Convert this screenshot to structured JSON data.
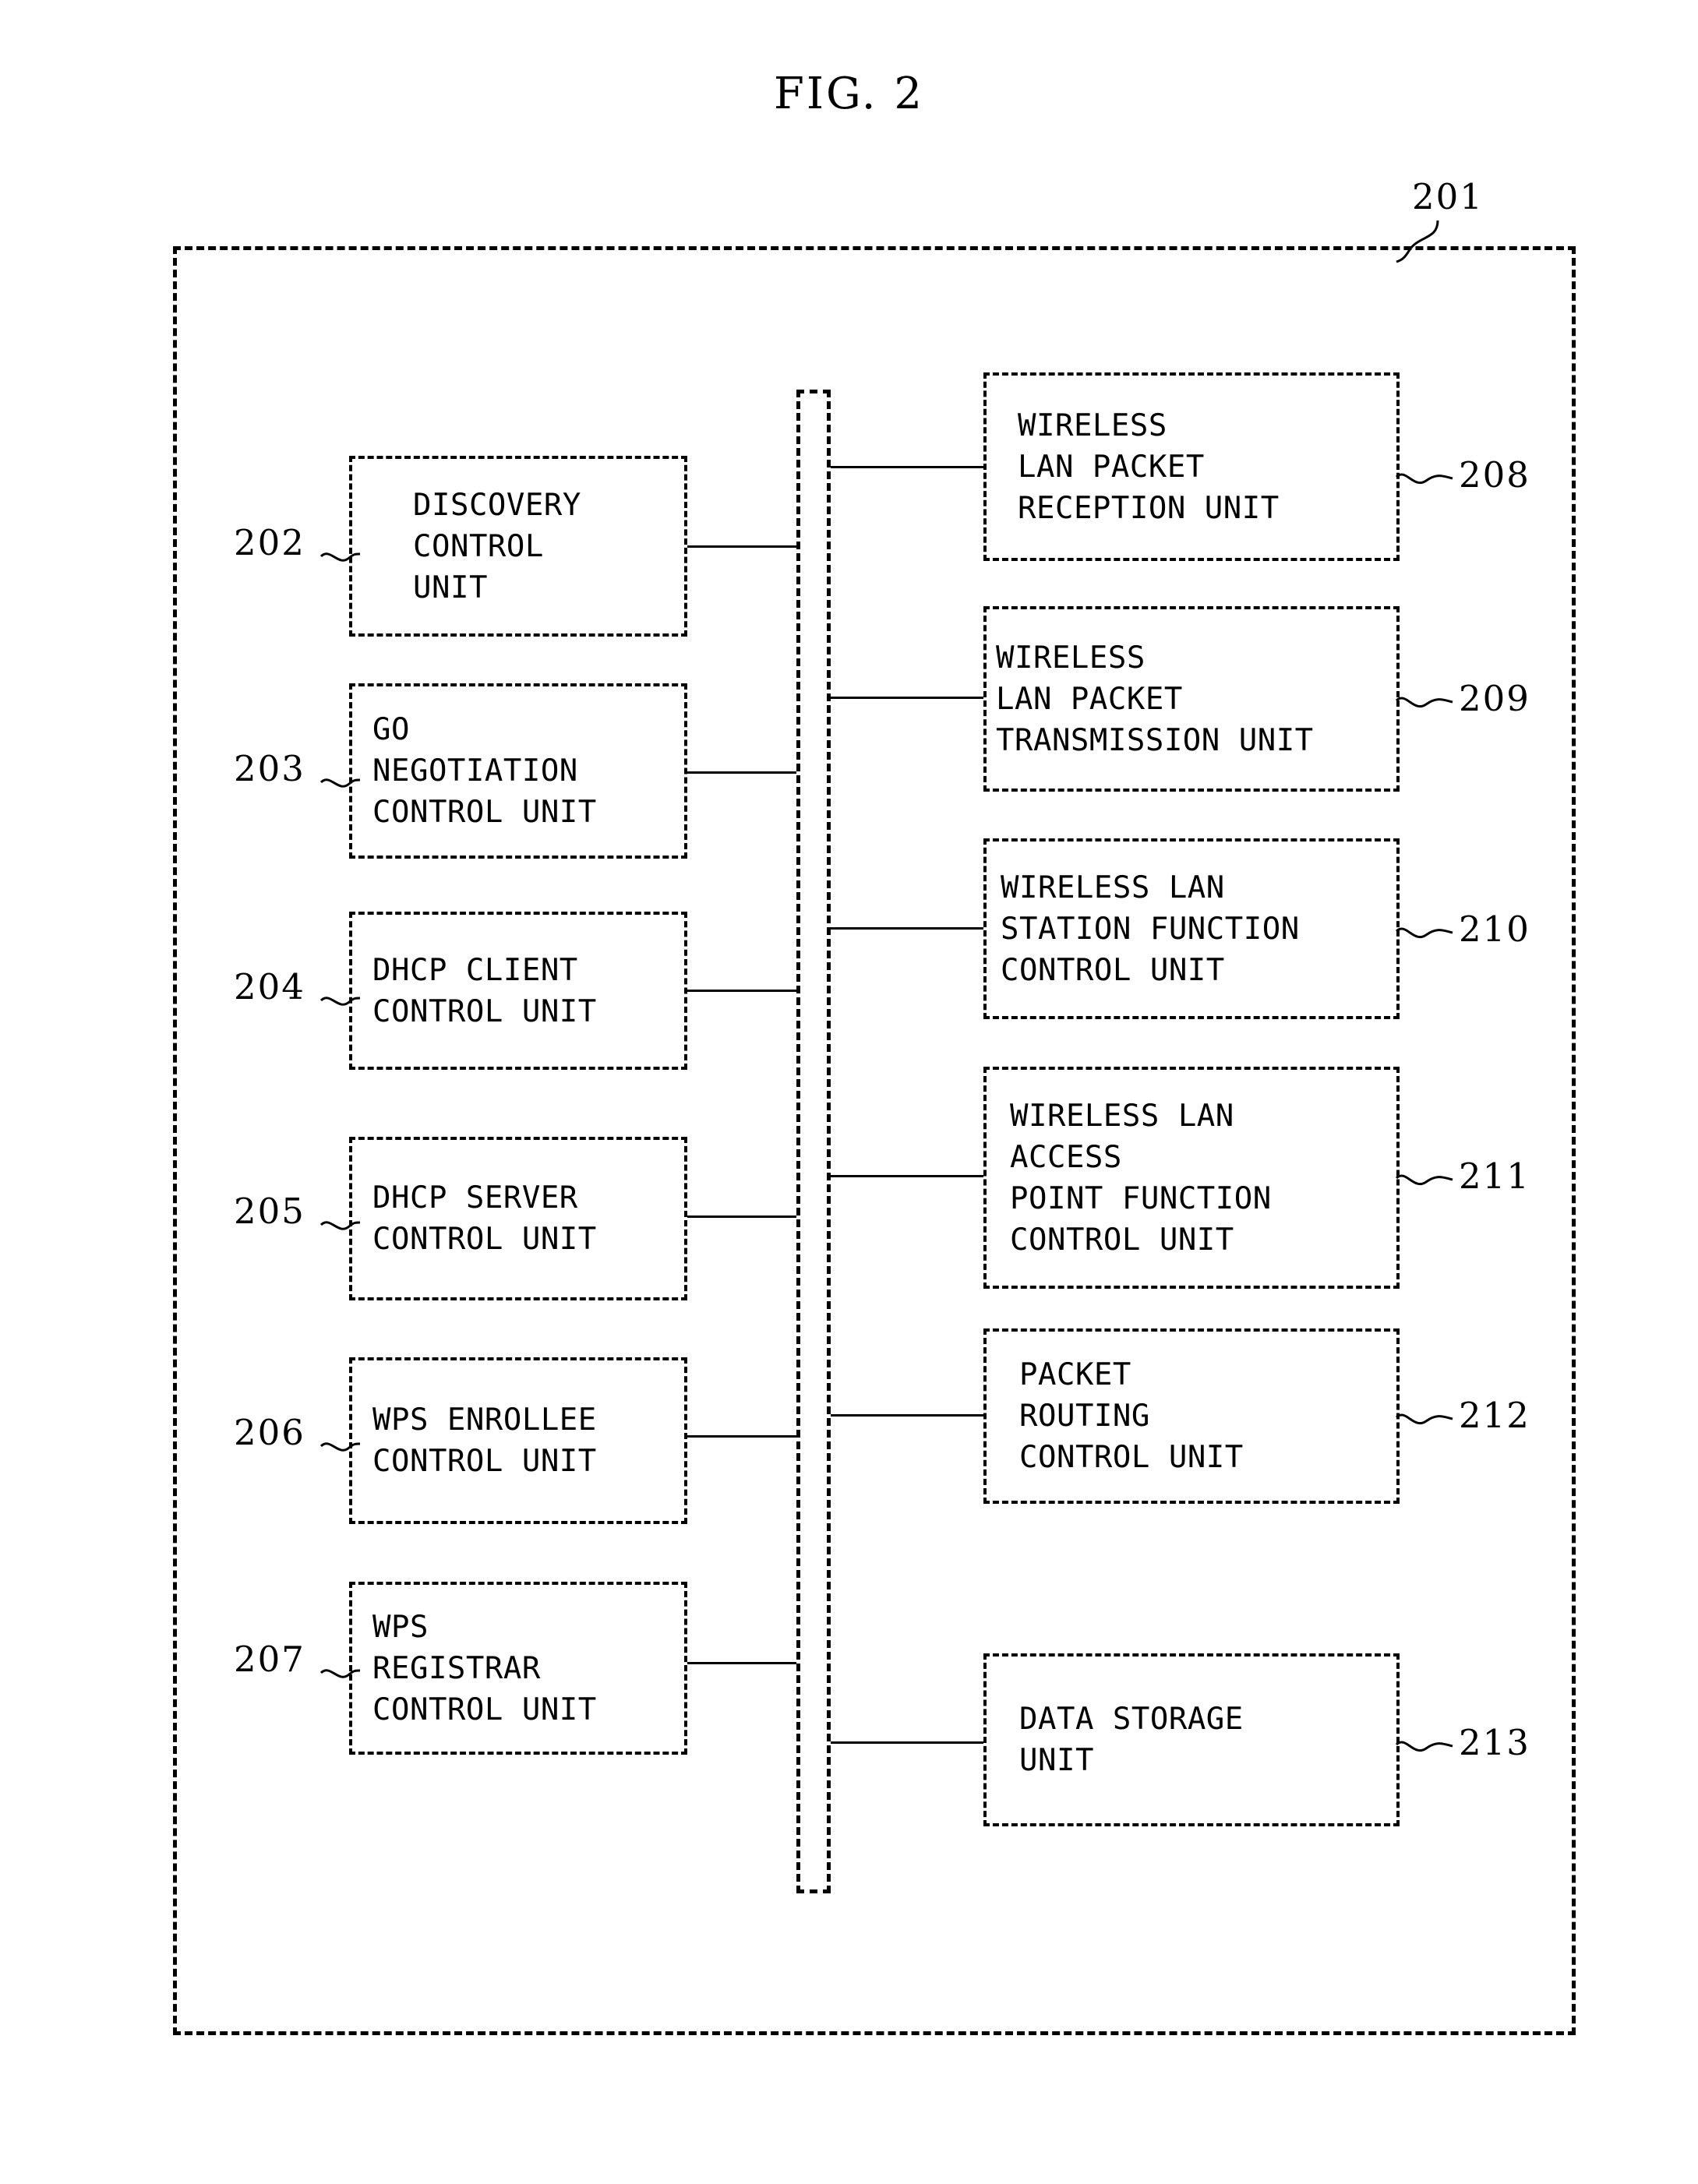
{
  "figure": {
    "title": "FIG. 2",
    "device_ref": "201"
  },
  "left_column": [
    {
      "ref": "202",
      "name": "discovery-control-unit",
      "lines": [
        "DISCOVERY",
        "CONTROL",
        "UNIT"
      ]
    },
    {
      "ref": "203",
      "name": "go-negotiation-control-unit",
      "lines": [
        "GO",
        "NEGOTIATION",
        "CONTROL UNIT"
      ]
    },
    {
      "ref": "204",
      "name": "dhcp-client-control-unit",
      "lines": [
        "DHCP CLIENT",
        "CONTROL UNIT"
      ]
    },
    {
      "ref": "205",
      "name": "dhcp-server-control-unit",
      "lines": [
        "DHCP SERVER",
        "CONTROL UNIT"
      ]
    },
    {
      "ref": "206",
      "name": "wps-enrollee-control-unit",
      "lines": [
        "WPS ENROLLEE",
        "CONTROL UNIT"
      ]
    },
    {
      "ref": "207",
      "name": "wps-registrar-control-unit",
      "lines": [
        "WPS",
        "REGISTRAR",
        "CONTROL UNIT"
      ]
    }
  ],
  "right_column": [
    {
      "ref": "208",
      "name": "wireless-lan-packet-reception-unit",
      "lines": [
        "WIRELESS",
        "LAN PACKET",
        "RECEPTION UNIT"
      ]
    },
    {
      "ref": "209",
      "name": "wireless-lan-packet-transmission-unit",
      "lines": [
        "WIRELESS",
        "LAN PACKET",
        "TRANSMISSION UNIT"
      ]
    },
    {
      "ref": "210",
      "name": "wireless-lan-station-function-control-unit",
      "lines": [
        "WIRELESS LAN",
        "STATION FUNCTION",
        "CONTROL UNIT"
      ]
    },
    {
      "ref": "211",
      "name": "wireless-lan-access-point-function-control-unit",
      "lines": [
        "WIRELESS LAN",
        "ACCESS",
        "POINT FUNCTION",
        "CONTROL UNIT"
      ]
    },
    {
      "ref": "212",
      "name": "packet-routing-control-unit",
      "lines": [
        "PACKET",
        "ROUTING",
        "CONTROL UNIT"
      ]
    },
    {
      "ref": "213",
      "name": "data-storage-unit",
      "lines": [
        "DATA STORAGE",
        "UNIT"
      ]
    }
  ],
  "bus": {
    "name": "system-bus"
  }
}
